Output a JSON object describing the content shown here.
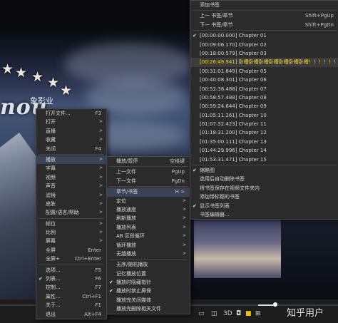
{
  "main_menu": {
    "items": [
      {
        "label": "打开文件...",
        "shortcut": "F3"
      },
      {
        "label": "打开",
        "arrow": ">"
      },
      {
        "label": "直播",
        "arrow": ">"
      },
      {
        "label": "收藏",
        "arrow": ">"
      },
      {
        "label": "关闭",
        "shortcut": "F4"
      },
      {
        "sep": true
      },
      {
        "label": "播放",
        "arrow": ">",
        "highlight": true
      },
      {
        "label": "字幕",
        "arrow": ">"
      },
      {
        "label": "视频",
        "arrow": ">"
      },
      {
        "label": "声音",
        "arrow": ">"
      },
      {
        "label": "滤镜",
        "arrow": ">"
      },
      {
        "label": "皮肤",
        "arrow": ">"
      },
      {
        "label": "配置/语言/帮助",
        "arrow": ">"
      },
      {
        "sep": true
      },
      {
        "label": "帧位",
        "arrow": ">"
      },
      {
        "label": "比例",
        "arrow": ">"
      },
      {
        "label": "屏幕",
        "arrow": ">"
      },
      {
        "label": "全屏",
        "shortcut": "Enter"
      },
      {
        "label": "全屏+",
        "shortcut": "Ctrl+Enter"
      },
      {
        "sep": true
      },
      {
        "label": "选项...",
        "shortcut": "F5"
      },
      {
        "label": "列表...",
        "shortcut": "F6",
        "check": true
      },
      {
        "label": "控制...",
        "shortcut": "F7"
      },
      {
        "label": "属性...",
        "shortcut": "Ctrl+F1"
      },
      {
        "label": "关于...",
        "shortcut": "F1"
      },
      {
        "label": "退出",
        "shortcut": "Alt+F4"
      }
    ]
  },
  "play_menu": {
    "items": [
      {
        "label": "播放/暂停",
        "shortcut": "空格键"
      },
      {
        "sep": true
      },
      {
        "label": "上一文件",
        "shortcut": "PgUp"
      },
      {
        "label": "下一文件",
        "shortcut": "PgDn"
      },
      {
        "sep": true
      },
      {
        "label": "章节/书签",
        "shortcut": "H >",
        "highlight": true
      },
      {
        "label": "定位",
        "arrow": ">"
      },
      {
        "label": "播放速度",
        "arrow": ">"
      },
      {
        "label": "刷新播放",
        "arrow": ">"
      },
      {
        "label": "播放列表",
        "arrow": ">"
      },
      {
        "label": "AB 区段循环",
        "arrow": ">"
      },
      {
        "label": "循环播放",
        "arrow": ">"
      },
      {
        "label": "无缝播放",
        "arrow": ">"
      },
      {
        "sep": true
      },
      {
        "label": "无序/随机播放"
      },
      {
        "label": "记忆播放位置"
      },
      {
        "label": "播放时隐藏指针",
        "check": true
      },
      {
        "label": "播放时禁止屏保",
        "check": true
      },
      {
        "label": "播放完关闭媒体"
      },
      {
        "label": "播放完删除相关文件"
      }
    ]
  },
  "chapter_menu": {
    "items": [
      {
        "label": "添加书签"
      },
      {
        "sep": true
      },
      {
        "label": "上一 书签/章节",
        "shortcut": "Shift+PgUp"
      },
      {
        "label": "下一 书签/章节",
        "shortcut": "Shift+PgDn"
      },
      {
        "sep": true
      },
      {
        "label": "[00:00:00.000] Chapter 01",
        "check": true
      },
      {
        "label": "[00:09:06.170] Chapter 02"
      },
      {
        "label": "[00:18:00.579] Chapter 03"
      },
      {
        "label": "[00:26:49.941] 卧槽卧槽卧槽卧槽卧槽卧槽卧槽！！！！！！",
        "highlight": true,
        "yellow": true
      },
      {
        "label": "[00:31:01.849] Chapter 05"
      },
      {
        "label": "[00:40:08.301] Chapter 06"
      },
      {
        "label": "[00:52:38.488] Chapter 07"
      },
      {
        "label": "[00:58:57.488] Chapter 08"
      },
      {
        "label": "[00:59:24.644] Chapter 09"
      },
      {
        "label": "[01:05:11.261] Chapter 10"
      },
      {
        "label": "[01:07:32.423] Chapter 11"
      },
      {
        "label": "[01:18:31.200] Chapter 12"
      },
      {
        "label": "[01:35:00.111] Chapter 13"
      },
      {
        "label": "[01:44:29.996] Chapter 14"
      },
      {
        "label": "[01:53:31.471] Chapter 15"
      },
      {
        "sep": true
      },
      {
        "label": "缩略图",
        "check": true
      },
      {
        "label": "选用后自动删除书签"
      },
      {
        "label": "将书签保存在视频文件夹内"
      },
      {
        "label": "添加带标题的书签"
      },
      {
        "label": "显示书签列表",
        "check": true
      },
      {
        "label": "书签编辑器..."
      }
    ]
  },
  "watermark": "知乎用户",
  "logo": {
    "text": "nou",
    "cn": "象影业"
  }
}
